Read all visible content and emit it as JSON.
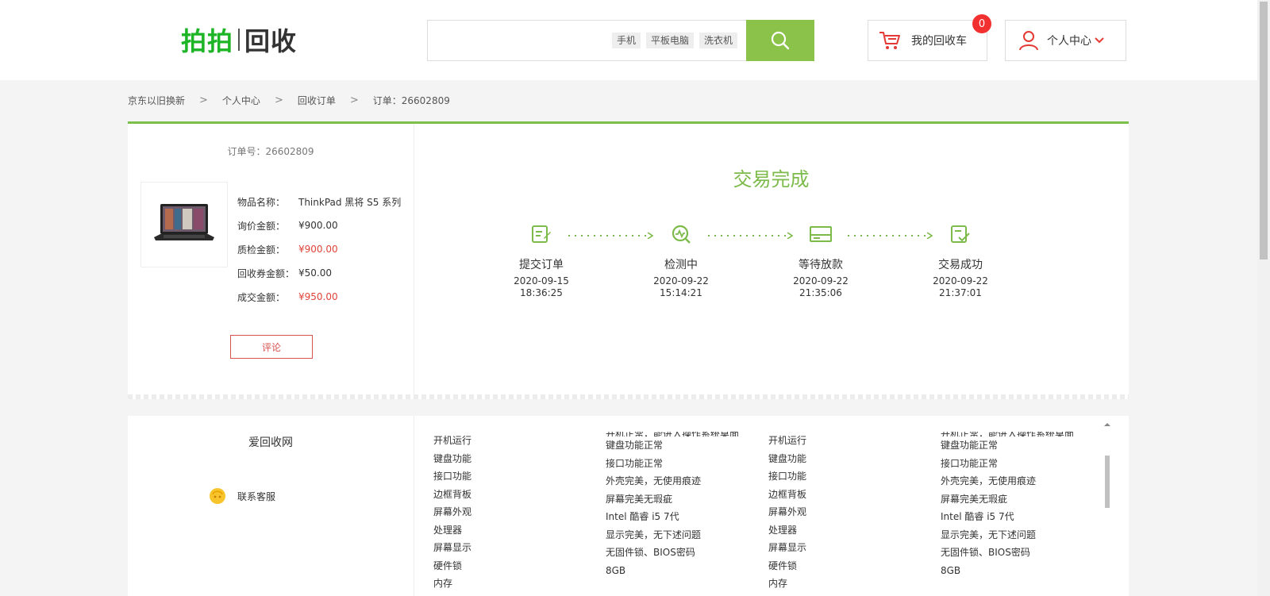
{
  "header": {
    "logo_brand": "拍拍",
    "logo_product": "回收",
    "search_tags": [
      "手机",
      "平板电脑",
      "洗衣机"
    ],
    "search_icon": "search-icon",
    "cart_label": "我的回收车",
    "cart_count": "0",
    "user_label": "个人中心",
    "accent_color": "#8bc34a"
  },
  "breadcrumb": {
    "items": [
      "京东以旧换新",
      "个人中心",
      "回收订单",
      "订单：26602809"
    ],
    "separator": ">"
  },
  "order": {
    "order_no": "订单号：26602809",
    "fields": [
      {
        "label": "物品名称：",
        "value": "ThinkPad 黑将 S5 系列",
        "highlight": false
      },
      {
        "label": "询价金额：",
        "value": "¥900.00",
        "highlight": false
      },
      {
        "label": "质检金额：",
        "value": "¥900.00",
        "highlight": true
      },
      {
        "label": "回收券金额：",
        "value": "¥50.00",
        "highlight": false
      },
      {
        "label": "成交金额：",
        "value": "¥950.00",
        "highlight": true
      }
    ],
    "comment_button": "评论",
    "status_title": "交易完成",
    "steps": [
      {
        "name": "提交订单",
        "date": "2020-09-15",
        "time": "18:36:25",
        "icon": "edit-document-icon"
      },
      {
        "name": "检测中",
        "date": "2020-09-22",
        "time": "15:14:21",
        "icon": "inspect-icon"
      },
      {
        "name": "等待放款",
        "date": "2020-09-22",
        "time": "21:35:06",
        "icon": "card-icon"
      },
      {
        "name": "交易成功",
        "date": "2020-09-22",
        "time": "21:37:01",
        "icon": "check-document-icon"
      }
    ]
  },
  "detail": {
    "shop_name": "爱回收网",
    "service_label": "联系客服",
    "left_labels": [
      "开机运行",
      "键盘功能",
      "接口功能",
      "边框背板",
      "屏幕外观",
      "处理器",
      "屏幕显示",
      "硬件锁",
      "内存"
    ],
    "left_values": [
      "开机正常，能进入操作系统桌面",
      "键盘功能正常",
      "接口功能正常",
      "外壳完美，无使用痕迹",
      "屏幕完美无瑕疵",
      "Intel 酷睿 i5 7代",
      "显示完美，无下述问题",
      "无固件锁、BIOS密码",
      "8GB"
    ],
    "right_labels": [
      "开机运行",
      "键盘功能",
      "接口功能",
      "边框背板",
      "屏幕外观",
      "处理器",
      "屏幕显示",
      "硬件锁",
      "内存"
    ],
    "right_values": [
      "开机正常，能进入操作系统桌面",
      "键盘功能正常",
      "接口功能正常",
      "外壳完美，无使用痕迹",
      "屏幕完美无瑕疵",
      "Intel 酷睿 i5 7代",
      "显示完美，无下述问题",
      "无固件锁、BIOS密码",
      "8GB"
    ]
  }
}
